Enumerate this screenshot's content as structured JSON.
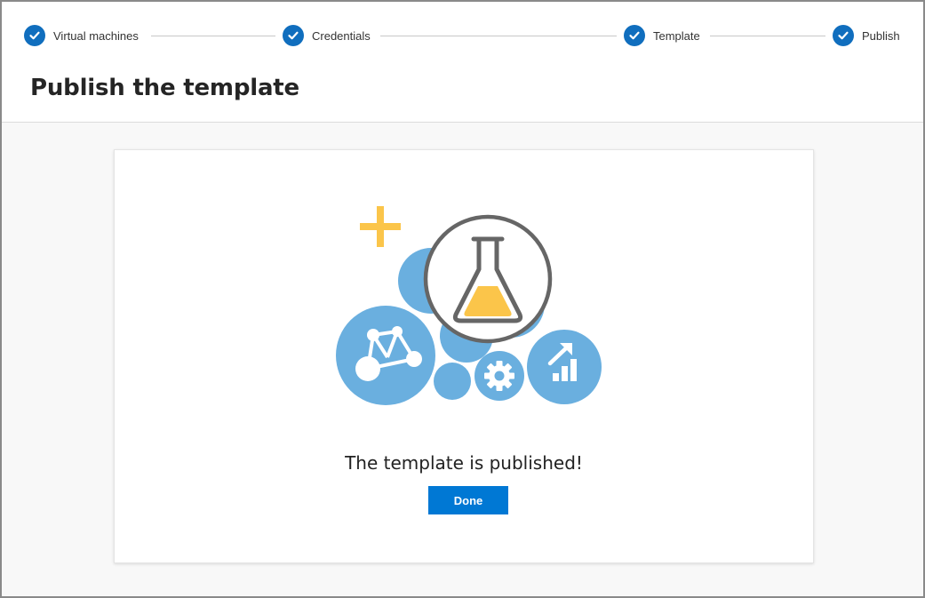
{
  "wizard": {
    "steps": [
      {
        "label": "Virtual machines",
        "status": "complete"
      },
      {
        "label": "Credentials",
        "status": "complete"
      },
      {
        "label": "Template",
        "status": "complete"
      },
      {
        "label": "Publish",
        "status": "complete"
      }
    ]
  },
  "page": {
    "title": "Publish the template"
  },
  "result": {
    "message": "The template is published!",
    "done_label": "Done"
  },
  "colors": {
    "step_accent": "#106ebe",
    "button": "#0078d4",
    "bubble_blue": "#6aafdf",
    "flask_fill": "#fbc54a",
    "plus_color": "#fbc54a"
  },
  "icons": [
    "check-icon",
    "flask-icon",
    "network-icon",
    "gear-icon",
    "chart-up-icon",
    "plus-icon"
  ]
}
